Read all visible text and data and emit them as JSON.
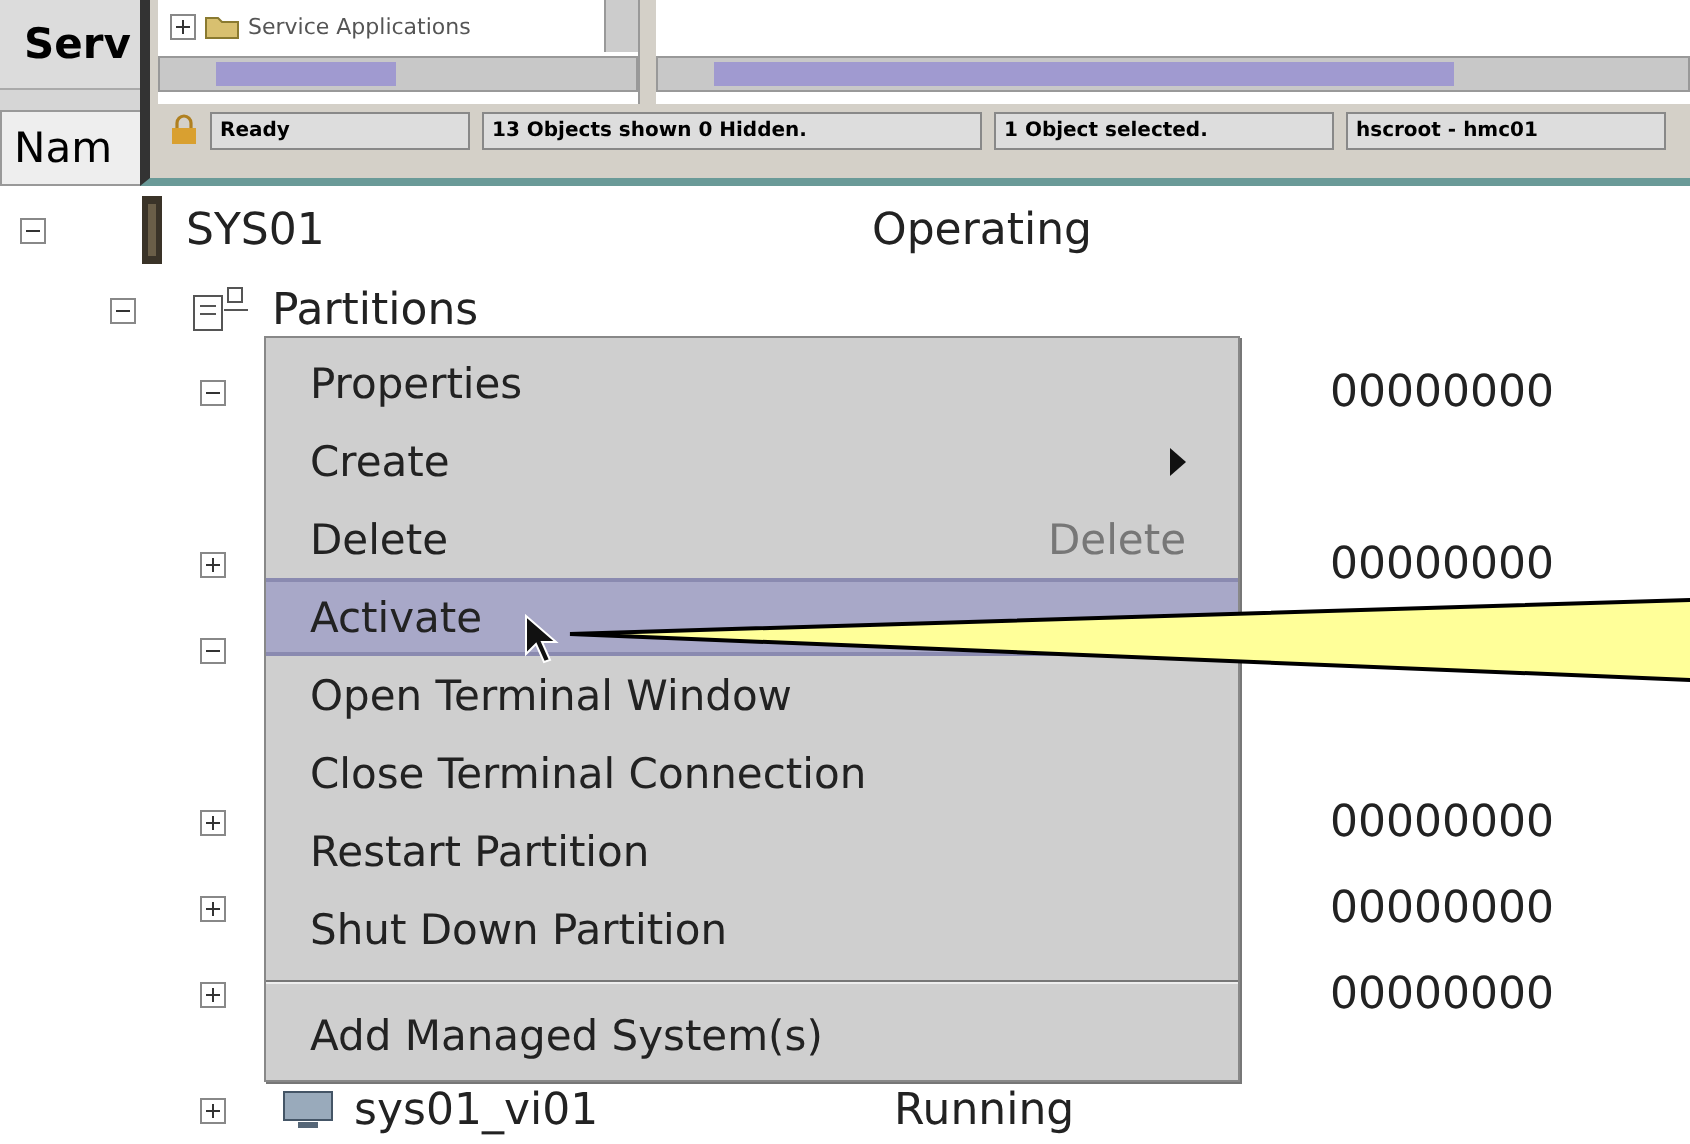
{
  "background_window": {
    "button": "Serv",
    "column_header": "Nam"
  },
  "inner_window": {
    "tree_item": {
      "label": "Service Applications",
      "expanded": false
    },
    "status_bar": [
      "Ready",
      "13 Objects shown 0 Hidden.",
      "1 Object selected.",
      "hscroot - hmc01"
    ]
  },
  "tree": {
    "root": {
      "label": "SYS01",
      "status": "Operating",
      "expanded": true
    },
    "group": {
      "label": "Partitions",
      "expanded": true
    },
    "rows": [
      {
        "kind": "node",
        "expanded": true,
        "value": "00000000"
      },
      {
        "kind": "blank"
      },
      {
        "kind": "node",
        "expanded": false,
        "value": "00000000"
      },
      {
        "kind": "node",
        "expanded": true
      },
      {
        "kind": "blank"
      },
      {
        "kind": "node",
        "expanded": false,
        "value": "00000000"
      },
      {
        "kind": "node",
        "expanded": false,
        "value": "00000000"
      },
      {
        "kind": "node",
        "expanded": false,
        "value": "00000000"
      },
      {
        "kind": "node",
        "expanded": false,
        "label": "sys01_vi01",
        "status": "Running"
      }
    ]
  },
  "context_menu": [
    {
      "label": "Properties",
      "kind": "plain",
      "selected": false
    },
    {
      "label": "Create",
      "kind": "submenu",
      "selected": false
    },
    {
      "label": "Delete",
      "kind": "shortcut",
      "shortcut": "Delete",
      "selected": false
    },
    {
      "label": "Activate",
      "kind": "plain",
      "selected": true
    },
    {
      "label": "Open Terminal Window",
      "kind": "plain",
      "selected": false
    },
    {
      "label": "Close Terminal Connection",
      "kind": "plain",
      "selected": false
    },
    {
      "label": "Restart Partition",
      "kind": "plain",
      "selected": false
    },
    {
      "label": "Shut Down Partition",
      "kind": "plain",
      "selected": false
    },
    {
      "kind": "separator"
    },
    {
      "label": "Add Managed System(s)",
      "kind": "plain",
      "selected": false
    }
  ]
}
